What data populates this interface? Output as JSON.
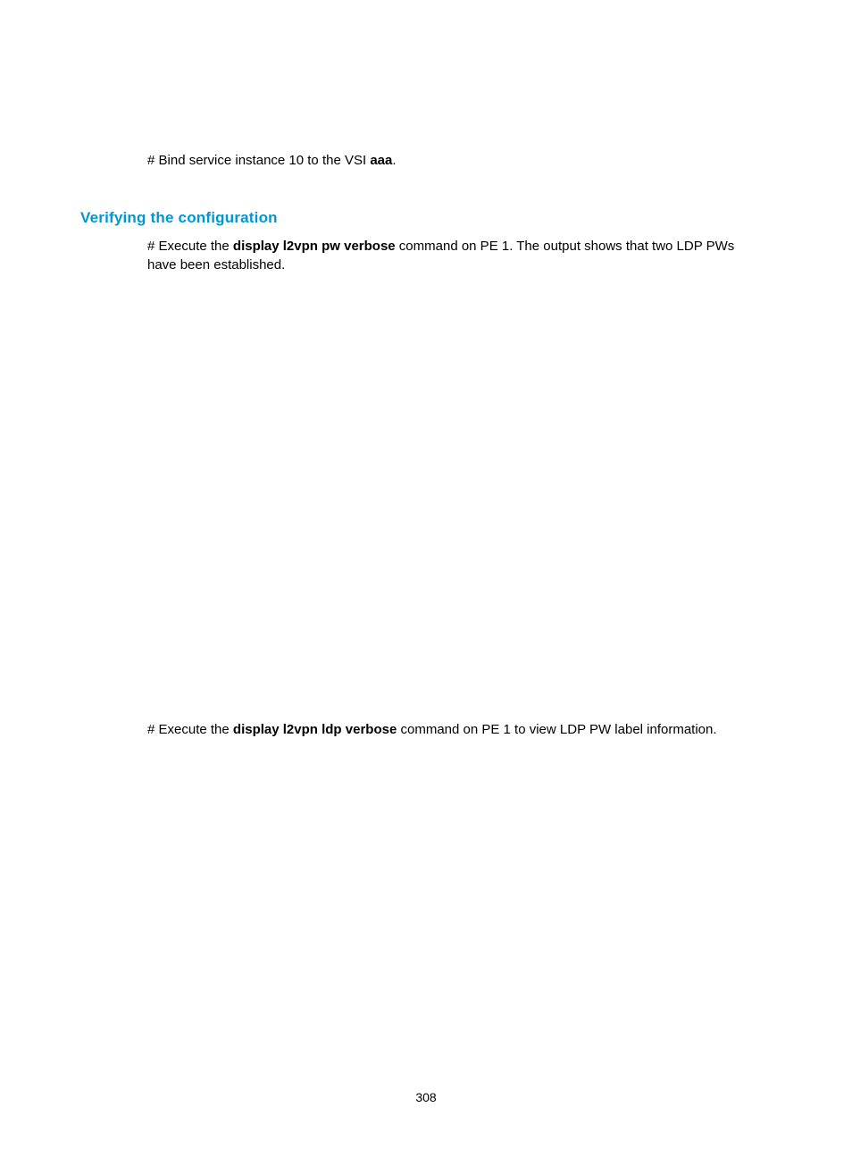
{
  "body": {
    "para1_pre": "# Bind service instance 10 to the VSI ",
    "para1_bold": "aaa",
    "para1_post": "."
  },
  "heading": "Verifying the configuration",
  "para2": {
    "pre": "# Execute the ",
    "bold": "display l2vpn pw verbose",
    "post": " command on PE 1. The output shows that two LDP PWs have been established."
  },
  "para3": {
    "pre": "# Execute the ",
    "bold": "display l2vpn ldp verbose",
    "post": " command on PE 1 to view LDP PW label information."
  },
  "page_number": "308"
}
